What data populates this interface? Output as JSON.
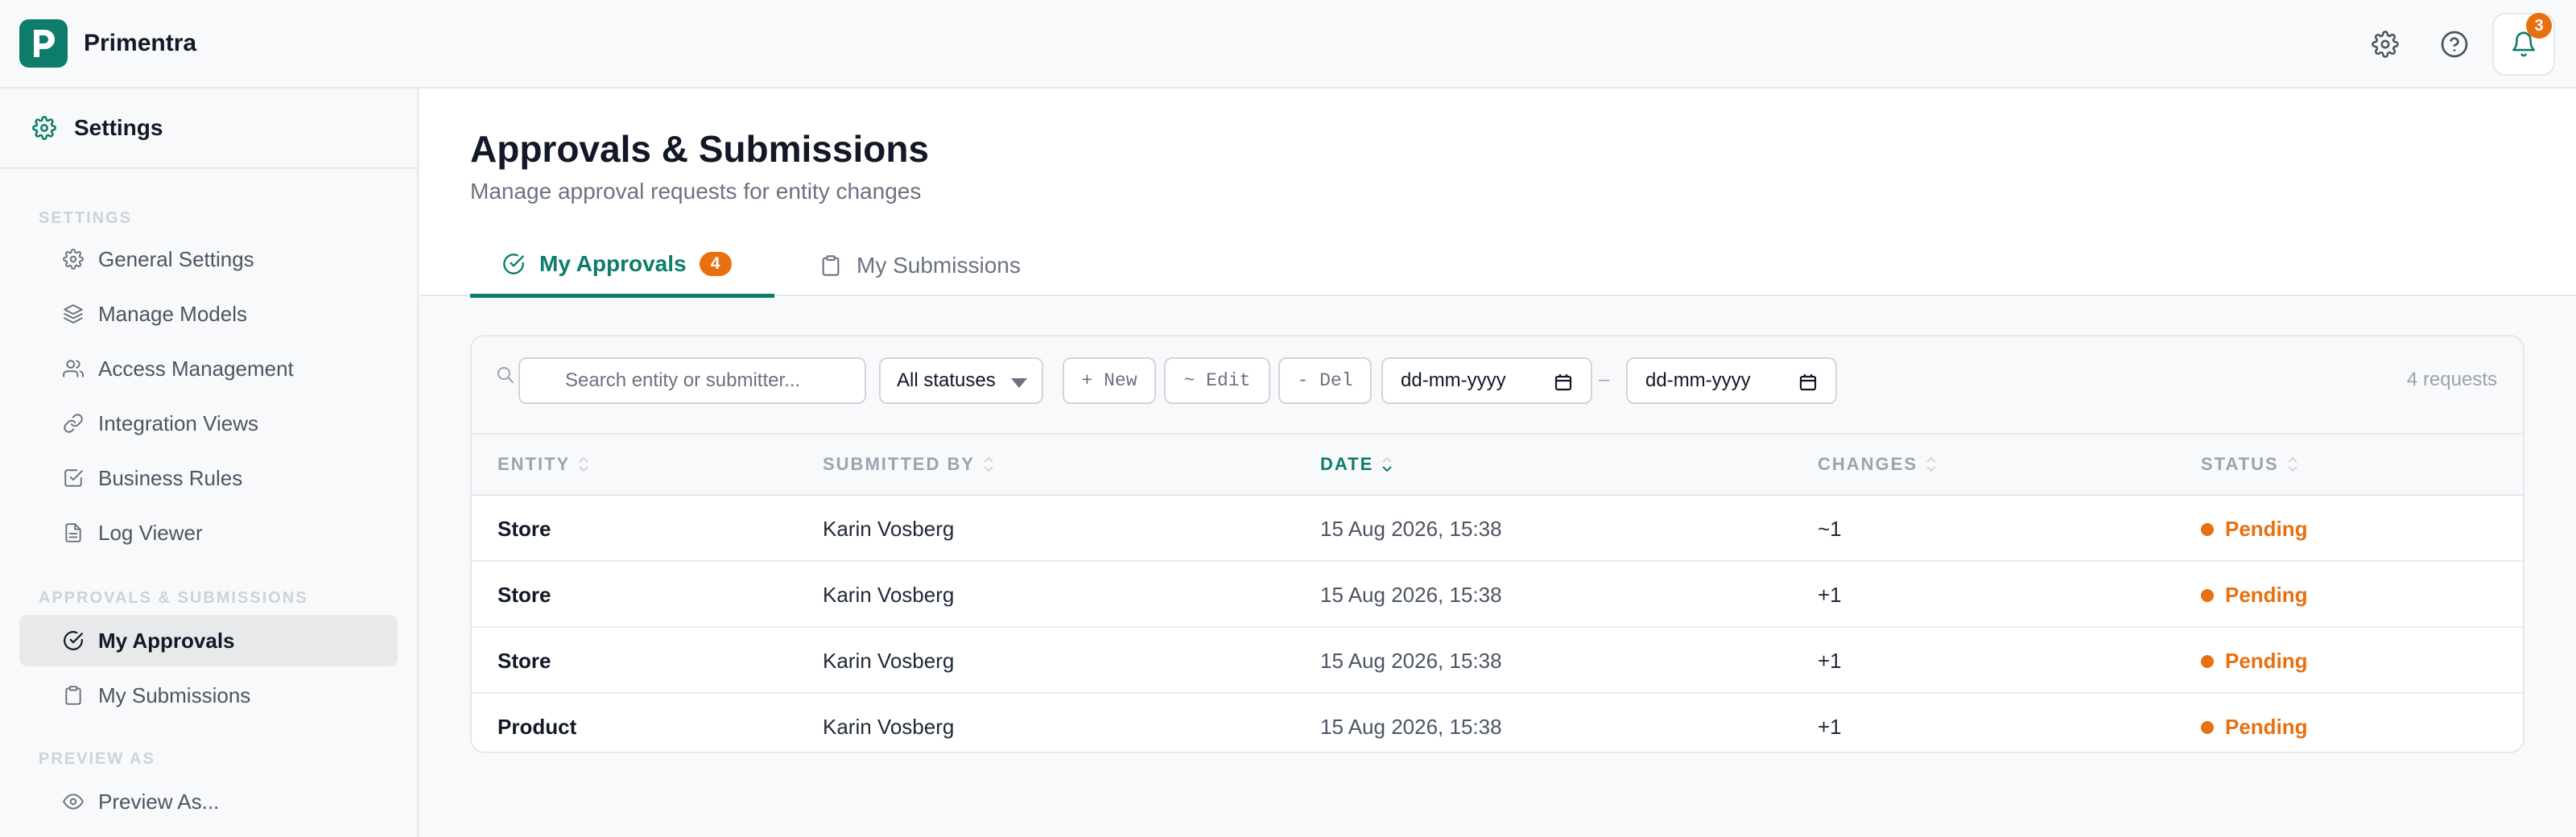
{
  "app": {
    "name": "Primentra"
  },
  "topbar": {
    "notification_count": "3",
    "icons": [
      "gear-icon",
      "help-icon",
      "bell-icon"
    ]
  },
  "sidebar": {
    "header": "Settings",
    "sections": [
      {
        "label": "SETTINGS",
        "items": [
          {
            "label": "General Settings",
            "icon": "gear-icon"
          },
          {
            "label": "Manage Models",
            "icon": "layers-icon"
          },
          {
            "label": "Access Management",
            "icon": "users-icon"
          },
          {
            "label": "Integration Views",
            "icon": "link-icon"
          },
          {
            "label": "Business Rules",
            "icon": "checkbox-icon"
          },
          {
            "label": "Log Viewer",
            "icon": "file-icon"
          }
        ]
      },
      {
        "label": "APPROVALS & SUBMISSIONS",
        "items": [
          {
            "label": "My Approvals",
            "icon": "check-circle-icon",
            "active": true
          },
          {
            "label": "My Submissions",
            "icon": "clipboard-icon"
          }
        ]
      },
      {
        "label": "PREVIEW AS",
        "items": [
          {
            "label": "Preview As...",
            "icon": "eye-icon"
          }
        ]
      }
    ]
  },
  "page": {
    "title": "Approvals & Submissions",
    "subtitle": "Manage approval requests for entity changes",
    "tabs": [
      {
        "label": "My Approvals",
        "count": "4",
        "active": true
      },
      {
        "label": "My Submissions"
      }
    ]
  },
  "toolbar": {
    "search_placeholder": "Search entity or submitter...",
    "status_filter": "All statuses",
    "chips": [
      "+ New",
      "~ Edit",
      "- Del"
    ],
    "date_from_placeholder": "dd-mm-yyyy",
    "date_separator": "–",
    "date_to_placeholder": "dd-mm-yyyy",
    "request_count": "4 requests"
  },
  "table": {
    "columns": [
      "ENTITY",
      "SUBMITTED BY",
      "DATE",
      "CHANGES",
      "STATUS"
    ],
    "sorted_column": "DATE",
    "rows": [
      {
        "entity": "Store",
        "submitted_by": "Karin Vosberg",
        "date": "15 Aug 2026, 15:38",
        "changes": "~1",
        "status": "Pending"
      },
      {
        "entity": "Store",
        "submitted_by": "Karin Vosberg",
        "date": "15 Aug 2026, 15:38",
        "changes": "+1",
        "status": "Pending"
      },
      {
        "entity": "Store",
        "submitted_by": "Karin Vosberg",
        "date": "15 Aug 2026, 15:38",
        "changes": "+1",
        "status": "Pending"
      },
      {
        "entity": "Product",
        "submitted_by": "Karin Vosberg",
        "date": "15 Aug 2026, 15:38",
        "changes": "+1",
        "status": "Pending"
      }
    ]
  },
  "colors": {
    "accent": "#0d7c6b",
    "pending": "#e8700f",
    "badge": "#e8700f"
  }
}
